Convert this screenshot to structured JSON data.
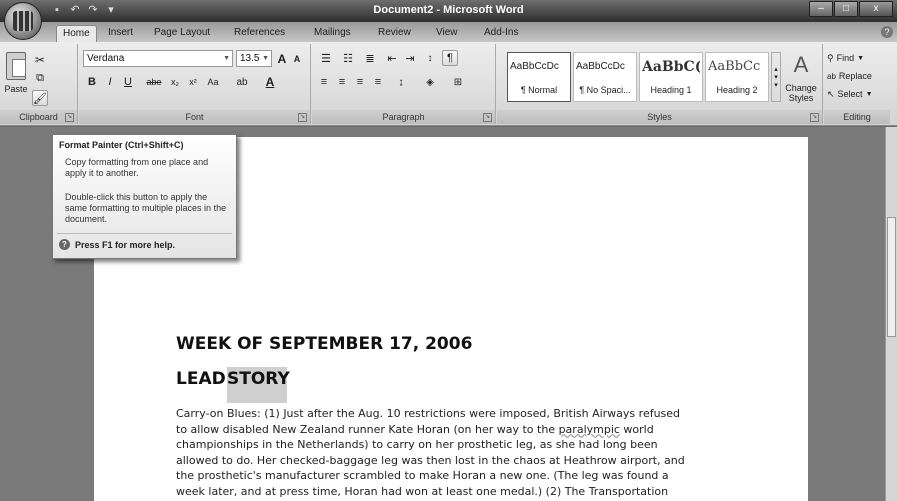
{
  "window": {
    "title": "Document2 - Microsoft Word",
    "minimize": "–",
    "maximize": "□",
    "close": "x"
  },
  "qat": {
    "save": "▪",
    "undo": "↶",
    "redo": "↷",
    "more": "▾"
  },
  "tabs": [
    "Home",
    "Insert",
    "Page Layout",
    "References",
    "Mailings",
    "Review",
    "View",
    "Add-Ins"
  ],
  "ribbon": {
    "clipboard": {
      "label": "Clipboard",
      "paste": "Paste"
    },
    "font": {
      "label": "Font",
      "name": "Verdana",
      "size": "13.5",
      "bold": "B",
      "italic": "I",
      "underline": "U",
      "strike": "abe",
      "subscript": "x₂",
      "superscript": "x²",
      "case": "Aa",
      "grow": "A",
      "shrink": "A"
    },
    "paragraph": {
      "label": "Paragraph"
    },
    "styles": {
      "label": "Styles",
      "items": [
        {
          "sample": "AaBbCcDc",
          "name": "¶ Normal"
        },
        {
          "sample": "AaBbCcDc",
          "name": "¶ No Spaci..."
        },
        {
          "sample": "AaBbC(",
          "name": "Heading 1"
        },
        {
          "sample": "AaBbCc",
          "name": "Heading 2"
        }
      ],
      "change": "Change Styles"
    },
    "editing": {
      "label": "Editing",
      "find": "Find",
      "replace": "Replace",
      "select": "Select"
    }
  },
  "tooltip": {
    "title": "Format Painter (Ctrl+Shift+C)",
    "p1": "Copy formatting from one place and apply it to another.",
    "p2": "Double-click this button to apply the same formatting to multiple places in the document.",
    "help": "Press F1 for more help."
  },
  "document": {
    "heading1": "WEEK OF SEPTEMBER 17, 2006",
    "heading2_prefix": "LEAD",
    "heading2_selected": "STORY",
    "lines": [
      "Carry-on Blues: (1) Just after the Aug. 10 restrictions were imposed, British Airways refused",
      "to allow disabled New Zealand runner Kate Horan (on her way to the paralympic world",
      "championships in the Netherlands) to carry on her prosthetic leg, as she had long been",
      "allowed to do. Her checked-baggage leg was then lost in the chaos at Heathrow airport, and",
      "the prosthetic's manufacturer scrambled to make Horan a new one. (The leg was found a",
      "week later, and at press time, Horan had won at least one medal.) (2) The Transportation"
    ]
  }
}
